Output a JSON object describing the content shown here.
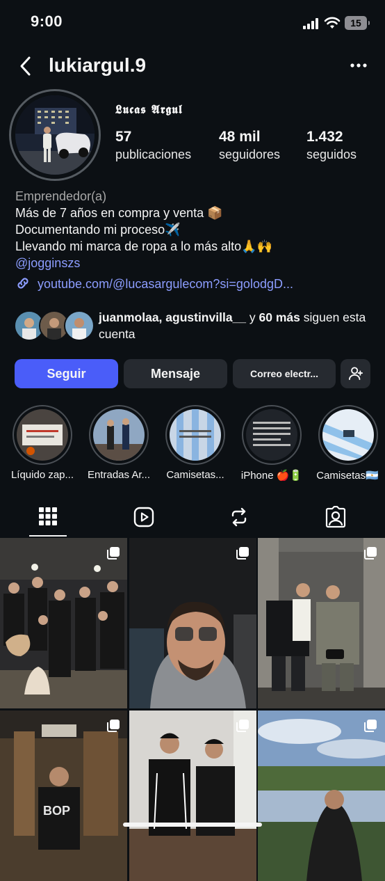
{
  "status_bar": {
    "time": "9:00",
    "battery": "15"
  },
  "header": {
    "username": "lukiargul.9"
  },
  "profile": {
    "display_name": "𝕷𝖚𝖈𝖆𝖘 𝕬𝖗𝖌𝖚𝖑",
    "stats": [
      {
        "value": "57",
        "label": "publicaciones"
      },
      {
        "value": "48 mil",
        "label": "seguidores"
      },
      {
        "value": "1.432",
        "label": "seguidos"
      }
    ],
    "category": "Emprendedor(a)",
    "bio_lines": [
      "Más de 7 años en compra y venta 📦",
      "Documentando mi proceso✈️",
      "Llevando mi marca de ropa a lo más alto🙏🙌"
    ],
    "mention": "@jogginszs",
    "link": "youtube.com/@lucasargulecom?si=golodgD..."
  },
  "followed_by": {
    "names": "juanmolaa, agustinvilla__",
    "and": " y ",
    "more": "60 más",
    "suffix": " siguen esta cuenta"
  },
  "actions": {
    "follow": "Seguir",
    "message": "Mensaje",
    "email": "Correo electr..."
  },
  "highlights": [
    {
      "label": "Líquido zap..."
    },
    {
      "label": "Entradas Ar..."
    },
    {
      "label": "Camisetas..."
    },
    {
      "label": "iPhone 🍎🔋"
    },
    {
      "label": "Camisetas🇦🇷"
    }
  ],
  "tabs": [
    {
      "icon": "grid-icon",
      "active": true
    },
    {
      "icon": "reels-icon",
      "active": false
    },
    {
      "icon": "reposts-icon",
      "active": false
    },
    {
      "icon": "tagged-icon",
      "active": false
    }
  ]
}
